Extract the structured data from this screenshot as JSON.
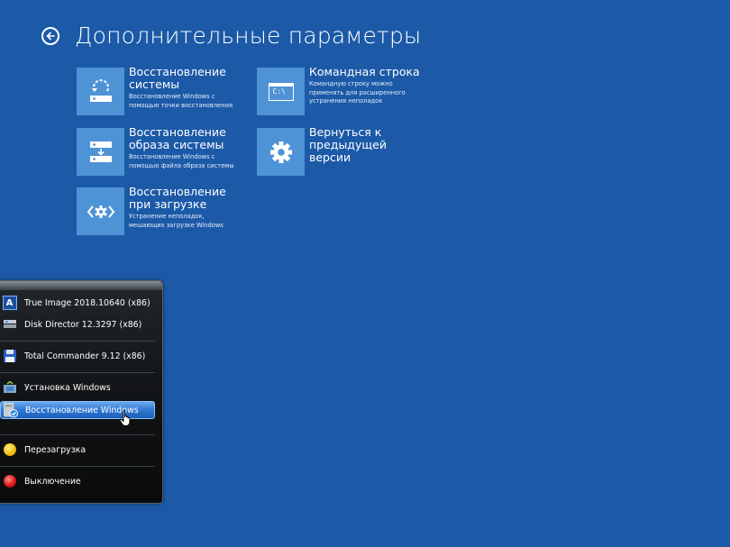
{
  "header": {
    "title": "Дополнительные параметры"
  },
  "tiles": [
    {
      "title": "Восстановление системы",
      "description": "Восстановление Windows с помощью точки восстановления",
      "icon": "system-restore-icon"
    },
    {
      "title": "Командная строка",
      "description": "Командную строку можно применять для расширенного устранения неполадок",
      "icon_text": "C:\\",
      "icon": "command-prompt-icon"
    },
    {
      "title": "Восстановление образа системы",
      "description": "Восстановление Windows с помощью файла образа системы",
      "icon": "image-recovery-icon"
    },
    {
      "title": "Вернуться к предыдущей версии",
      "description": "",
      "icon": "gear-icon"
    },
    {
      "title": "Восстановление при загрузке",
      "description": "Устранение неполадок, мешающих загрузке Windows",
      "icon": "startup-repair-icon"
    }
  ],
  "menu": {
    "items": [
      {
        "label": "True Image 2018.10640 (x86)",
        "icon": "acronis-icon"
      },
      {
        "label": "Disk Director 12.3297 (x86)",
        "icon": "disk-director-icon"
      },
      {
        "label": "Total Commander 9.12 (x86)",
        "icon": "floppy-icon"
      },
      {
        "label": "Установка Windows",
        "icon": "windows-setup-icon"
      },
      {
        "label": "Восстановление Windows",
        "icon": "windows-recovery-icon",
        "selected": true
      },
      {
        "label": "Перезагрузка",
        "icon": "restart-icon",
        "color": "#f2c012"
      },
      {
        "label": "Выключение",
        "icon": "shutdown-icon",
        "color": "#e01818"
      }
    ]
  },
  "colors": {
    "background": "#1c5aa8",
    "tile": "#4f93d7",
    "menu_highlight": "#2f78d4"
  }
}
